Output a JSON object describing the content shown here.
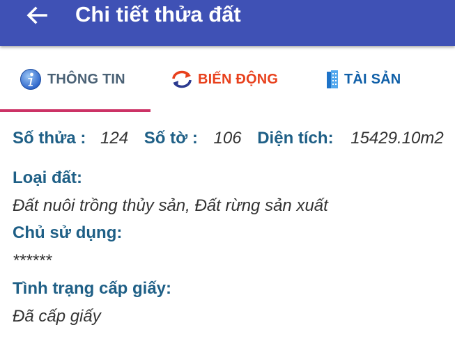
{
  "appbar": {
    "title": "Chi tiết thửa đất",
    "color": "#3f51b5"
  },
  "tabs": [
    {
      "label": "THÔNG TIN",
      "icon": "info-icon",
      "active": true
    },
    {
      "label": "BIẾN ĐỘNG",
      "icon": "refresh-icon",
      "active": false
    },
    {
      "label": "TÀI SẢN",
      "icon": "building-icon",
      "active": false
    }
  ],
  "summary": {
    "so_thua_label": "Số thửa :",
    "so_thua_value": "124",
    "so_to_label": "Số tờ :",
    "so_to_value": "106",
    "dien_tich_label": "Diện tích:",
    "dien_tich_value": "15429.10m2"
  },
  "fields": [
    {
      "label": "Loại đất:",
      "value": "Đất nuôi trồng thủy sản, Đất rừng sản xuất"
    },
    {
      "label": "Chủ sử dụng:",
      "value": "******"
    },
    {
      "label": "Tình trạng cấp giấy:",
      "value": "Đã cấp giấy"
    }
  ],
  "colors": {
    "label": "#1e5f86",
    "value": "#333333",
    "tab_indicator": "#cc3366"
  }
}
